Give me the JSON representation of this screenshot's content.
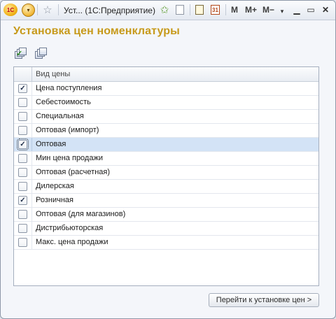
{
  "titlebar": {
    "logo": "1С",
    "window_title": "Уст...  (1С:Предприятие)",
    "mem_buttons": [
      "M",
      "M+",
      "M−"
    ],
    "calendar_label": "31",
    "icons": [
      "1c-logo-icon",
      "dropdown-menu-icon",
      "favorite-star-icon",
      "add-favorite-icon",
      "document-icon",
      "calculator-icon",
      "calendar-icon"
    ]
  },
  "form": {
    "title": "Установка цен номенклатуры"
  },
  "table": {
    "column_header": "Вид цены",
    "rows": [
      {
        "name": "Цена поступления",
        "checked": true
      },
      {
        "name": "Себестоимость",
        "checked": false
      },
      {
        "name": "Специальная",
        "checked": false
      },
      {
        "name": "Оптовая (импорт)",
        "checked": false
      },
      {
        "name": "Оптовая",
        "checked": true,
        "selected": true
      },
      {
        "name": "Мин цена продажи",
        "checked": false
      },
      {
        "name": "Оптовая (расчетная)",
        "checked": false
      },
      {
        "name": "Дилерская",
        "checked": false
      },
      {
        "name": "Розничная",
        "checked": true
      },
      {
        "name": "Оптовая (для магазинов)",
        "checked": false
      },
      {
        "name": "Дистрибьюторская",
        "checked": false
      },
      {
        "name": "Макс. цена продажи",
        "checked": false
      }
    ]
  },
  "footer": {
    "go_button": "Перейти к установке цен >"
  },
  "colors": {
    "title": "#c79a1b",
    "selected_row": "#d3e3f6",
    "check_mark": "#1d2c47"
  }
}
